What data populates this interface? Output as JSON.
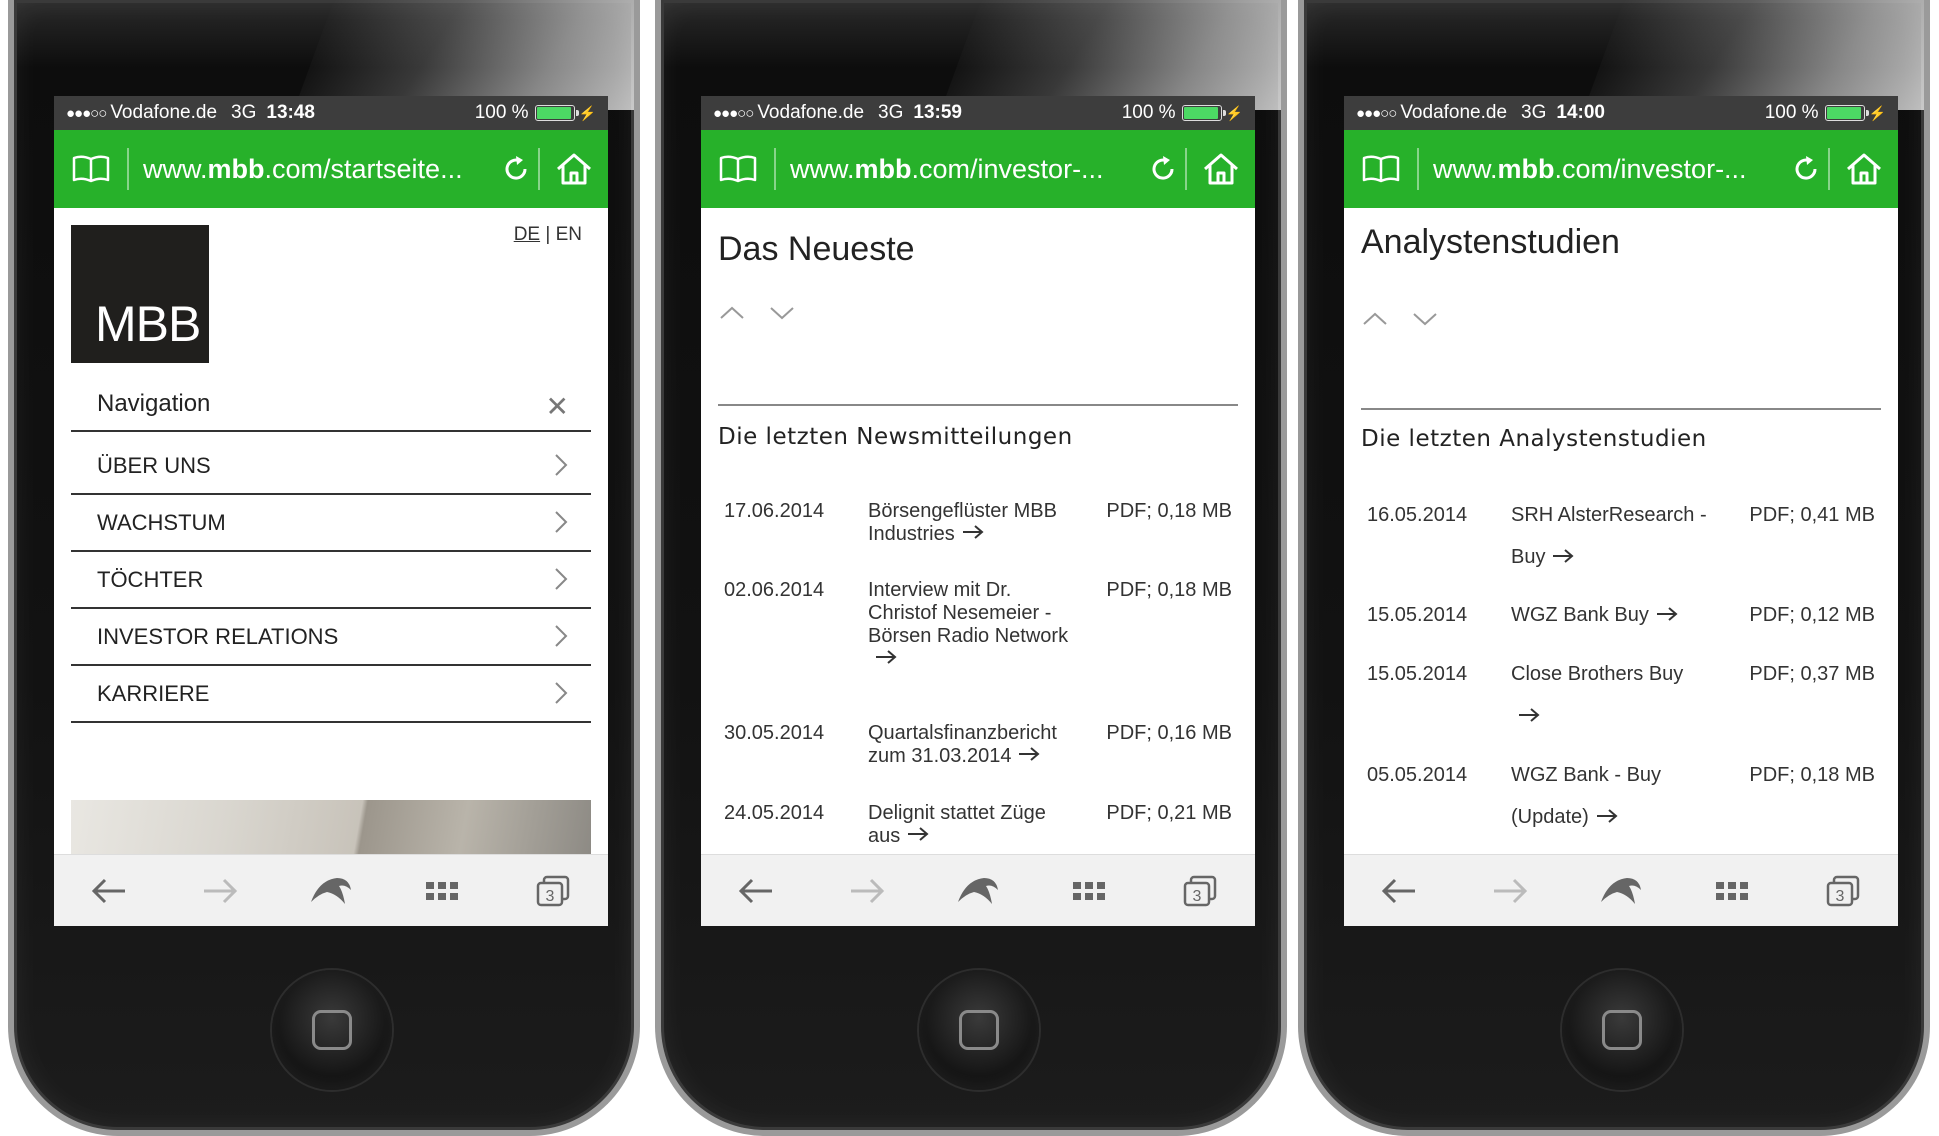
{
  "phones": [
    {
      "status": {
        "signal": "●●●○○",
        "carrier": "Vodafone.de",
        "network": "3G",
        "time": "13:48",
        "battery": "100 %"
      },
      "url": {
        "domain_pre": "www.",
        "domain_bold": "mbb",
        "domain_post": ".com/startseite..."
      },
      "logo": "MBB",
      "lang": {
        "de": "DE",
        "sep": "|",
        "en": "EN"
      },
      "nav_title": "Navigation",
      "nav_items": [
        "ÜBER UNS",
        "WACHSTUM",
        "TÖCHTER",
        "INVESTOR RELATIONS",
        "KARRIERE"
      ]
    },
    {
      "status": {
        "signal": "●●●○○",
        "carrier": "Vodafone.de",
        "network": "3G",
        "time": "13:59",
        "battery": "100 %"
      },
      "url": {
        "domain_pre": "www.",
        "domain_bold": "mbb",
        "domain_post": ".com/investor-..."
      },
      "page_title": "Das Neueste",
      "section_title": "Die letzten Newsmitteilungen",
      "rows": [
        {
          "date": "17.06.2014",
          "title": "Börsengeflüster MBB Industries",
          "size": "PDF; 0,18 MB"
        },
        {
          "date": "02.06.2014",
          "title": "Interview mit Dr. Christof Nesemeier - Börsen Radio Network",
          "size": "PDF; 0,18 MB"
        },
        {
          "date": "30.05.2014",
          "title": "Quartalsfinanzbericht zum 31.03.2014",
          "size": "PDF; 0,16 MB"
        },
        {
          "date": "24.05.2014",
          "title": "Delignit stattet Züge aus",
          "size": "PDF; 0,21 MB"
        }
      ]
    },
    {
      "status": {
        "signal": "●●●○○",
        "carrier": "Vodafone.de",
        "network": "3G",
        "time": "14:00",
        "battery": "100 %"
      },
      "url": {
        "domain_pre": "www.",
        "domain_bold": "mbb",
        "domain_post": ".com/investor-..."
      },
      "page_title": "Analystenstudien",
      "section_title": "Die letzten Analystenstudien",
      "rows": [
        {
          "date": "16.05.2014",
          "title": "SRH AlsterResearch - Buy",
          "size": "PDF; 0,41 MB"
        },
        {
          "date": "15.05.2014",
          "title": "WGZ Bank Buy",
          "size": "PDF; 0,12 MB"
        },
        {
          "date": "15.05.2014",
          "title": "Close Brothers Buy",
          "size": "PDF; 0,37 MB"
        },
        {
          "date": "05.05.2014",
          "title": "WGZ Bank - Buy (Update)",
          "size": "PDF; 0,18 MB"
        }
      ]
    }
  ],
  "colors": {
    "green_bar": "#27b12a",
    "status_bg": "#3d3d3d",
    "battery": "#4cd964"
  }
}
